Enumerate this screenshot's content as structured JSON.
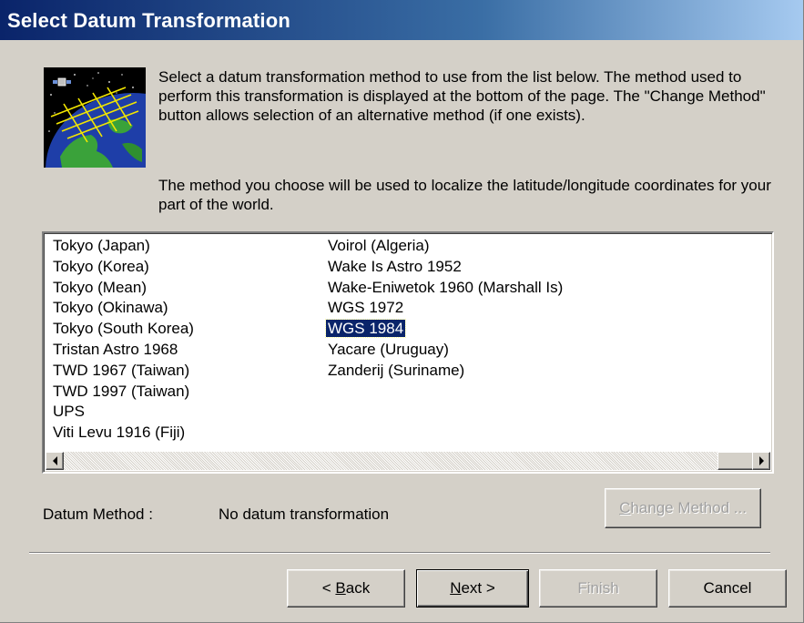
{
  "dialog": {
    "title": "Select Datum Transformation",
    "description_1": "Select a datum transformation method to use from the list below. The method used to perform this transformation is displayed at the bottom of the page. The \"Change Method\" button allows selection of an alternative method (if one exists).",
    "description_2": "The method you choose will be used to localize the latitude/longitude coordinates for your part of the world."
  },
  "datum_list": {
    "column_1": [
      "Tokyo (Japan)",
      "Tokyo (Korea)",
      "Tokyo (Mean)",
      "Tokyo (Okinawa)",
      "Tokyo (South Korea)",
      "Tristan Astro 1968",
      "TWD 1967 (Taiwan)",
      "TWD 1997 (Taiwan)",
      "UPS",
      "Viti Levu 1916 (Fiji)"
    ],
    "column_2": [
      "Voirol (Algeria)",
      "Wake Is Astro 1952",
      "Wake-Eniwetok 1960 (Marshall Is)",
      "WGS 1972",
      "WGS 1984",
      "Yacare (Uruguay)",
      "Zanderij (Suriname)"
    ],
    "selected": "WGS 1984"
  },
  "datum_method": {
    "label": "Datum Method :",
    "value": "No datum transformation"
  },
  "buttons": {
    "change_method": {
      "prefix": "",
      "mnemonic": "C",
      "rest": "hange Method ...",
      "enabled": false
    },
    "back": {
      "prefix": "< ",
      "mnemonic": "B",
      "rest": "ack",
      "enabled": true
    },
    "next": {
      "prefix": "",
      "mnemonic": "N",
      "rest": "ext >",
      "enabled": true
    },
    "finish": {
      "label": "Finish",
      "enabled": false
    },
    "cancel": {
      "label": "Cancel",
      "enabled": true
    }
  },
  "icons": {
    "globe": "globe-satellite-icon",
    "scroll_left": "scroll-left-arrow-icon",
    "scroll_right": "scroll-right-arrow-icon"
  },
  "colors": {
    "title_bar_start": "#0a246a",
    "title_bar_end": "#a6caf0",
    "dialog_face": "#d4d0c8",
    "selection": "#0a246a"
  }
}
